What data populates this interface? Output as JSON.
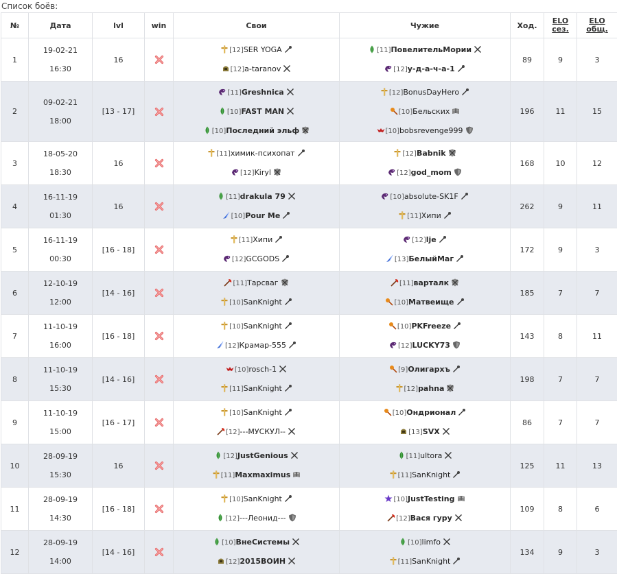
{
  "caption": "Список боёв:",
  "headers": {
    "num": "№",
    "date": "Дата",
    "lvl": "lvl",
    "win": "win",
    "own": "Свои",
    "enemy": "Чужие",
    "moves": "Ход.",
    "elo_season_1": "ELO",
    "elo_season_2": "сез.",
    "elo_total_1": "ELO",
    "elo_total_2": "общ."
  },
  "class_icons": {
    "knight": "cross-icon",
    "warrior": "helmet-icon",
    "druid": "leaf-icon",
    "necro": "dark-swirl-icon",
    "magician": "blue-drop-icon",
    "berserk": "red-axe-icon",
    "alchemist": "orange-key-icon",
    "vampire": "red-bat-icon",
    "demon": "purple-star-icon"
  },
  "status_icons": {
    "staff": "staff-icon",
    "cross": "dead-cross-icon",
    "shield": "shield-icon",
    "dead": "hatched-shield-icon",
    "book": "book-icon"
  },
  "battles": [
    {
      "num": "1",
      "date": "19-02-21",
      "time": "16:30",
      "lvl": "16",
      "own": [
        {
          "cls": "knight",
          "lvl": "[12]",
          "name": "SER YOGA",
          "bold": false,
          "st": "staff"
        },
        {
          "cls": "warrior",
          "lvl": "[12]",
          "name": "a-taranov",
          "bold": false,
          "st": "cross"
        }
      ],
      "enemy": [
        {
          "cls": "druid",
          "lvl": "[11]",
          "name": "ПовелительМории",
          "bold": true,
          "st": "cross"
        },
        {
          "cls": "necro",
          "lvl": "[12]",
          "name": "у-д-а-ч-а-1",
          "bold": true,
          "st": "staff"
        }
      ],
      "moves": "89",
      "elo_season": "9",
      "elo_total": "3"
    },
    {
      "num": "2",
      "date": "09-02-21",
      "time": "18:00",
      "lvl": "[13 - 17]",
      "own": [
        {
          "cls": "necro",
          "lvl": "[11]",
          "name": "Greshnica",
          "bold": true,
          "st": "cross"
        },
        {
          "cls": "druid",
          "lvl": "[10]",
          "name": "FAST MAN",
          "bold": true,
          "st": "cross"
        },
        {
          "cls": "druid",
          "lvl": "[10]",
          "name": "Последний эльф",
          "bold": true,
          "st": "dead"
        }
      ],
      "enemy": [
        {
          "cls": "knight",
          "lvl": "[12]",
          "name": "BonusDayHero",
          "bold": false,
          "st": "staff"
        },
        {
          "cls": "alchemist",
          "lvl": "[10]",
          "name": "Бельских",
          "bold": false,
          "st": "book"
        },
        {
          "cls": "vampire",
          "lvl": "[10]",
          "name": "bobsrevenge999",
          "bold": false,
          "st": "shield"
        }
      ],
      "moves": "196",
      "elo_season": "11",
      "elo_total": "15"
    },
    {
      "num": "3",
      "date": "18-05-20",
      "time": "18:30",
      "lvl": "16",
      "own": [
        {
          "cls": "knight",
          "lvl": "[11]",
          "name": "химик-психопат",
          "bold": false,
          "st": "staff"
        },
        {
          "cls": "necro",
          "lvl": "[12]",
          "name": "Kiryl",
          "bold": false,
          "st": "dead"
        }
      ],
      "enemy": [
        {
          "cls": "knight",
          "lvl": "[12]",
          "name": "Babnik",
          "bold": true,
          "st": "dead"
        },
        {
          "cls": "necro",
          "lvl": "[12]",
          "name": "god_mom",
          "bold": true,
          "st": "shield"
        }
      ],
      "moves": "168",
      "elo_season": "10",
      "elo_total": "12"
    },
    {
      "num": "4",
      "date": "16-11-19",
      "time": "01:30",
      "lvl": "16",
      "own": [
        {
          "cls": "druid",
          "lvl": "[11]",
          "name": "drakula 79",
          "bold": true,
          "st": "cross"
        },
        {
          "cls": "magician",
          "lvl": "[10]",
          "name": "Pour Me",
          "bold": true,
          "st": "staff"
        }
      ],
      "enemy": [
        {
          "cls": "necro",
          "lvl": "[10]",
          "name": "absolute-SK1F",
          "bold": false,
          "st": "staff"
        },
        {
          "cls": "knight",
          "lvl": "[11]",
          "name": "Хипи",
          "bold": false,
          "st": "staff"
        }
      ],
      "moves": "262",
      "elo_season": "9",
      "elo_total": "11"
    },
    {
      "num": "5",
      "date": "16-11-19",
      "time": "00:30",
      "lvl": "[16 - 18]",
      "own": [
        {
          "cls": "knight",
          "lvl": "[11]",
          "name": "Хипи",
          "bold": false,
          "st": "staff"
        },
        {
          "cls": "necro",
          "lvl": "[12]",
          "name": "GCGODS",
          "bold": false,
          "st": "staff"
        }
      ],
      "enemy": [
        {
          "cls": "necro",
          "lvl": "[12]",
          "name": "lje",
          "bold": true,
          "st": "staff"
        },
        {
          "cls": "magician",
          "lvl": "[13]",
          "name": "БелыйМаг",
          "bold": true,
          "st": "staff"
        }
      ],
      "moves": "172",
      "elo_season": "9",
      "elo_total": "3"
    },
    {
      "num": "6",
      "date": "12-10-19",
      "time": "12:00",
      "lvl": "[14 - 16]",
      "own": [
        {
          "cls": "berserk",
          "lvl": "[11]",
          "name": "Тарсваг",
          "bold": false,
          "st": "dead"
        },
        {
          "cls": "knight",
          "lvl": "[10]",
          "name": "SanKnight",
          "bold": false,
          "st": "staff"
        }
      ],
      "enemy": [
        {
          "cls": "berserk",
          "lvl": "[11]",
          "name": "варталк",
          "bold": true,
          "st": "dead"
        },
        {
          "cls": "alchemist",
          "lvl": "[10]",
          "name": "Матвеище",
          "bold": true,
          "st": "staff"
        }
      ],
      "moves": "185",
      "elo_season": "7",
      "elo_total": "7"
    },
    {
      "num": "7",
      "date": "11-10-19",
      "time": "16:00",
      "lvl": "[16 - 18]",
      "own": [
        {
          "cls": "knight",
          "lvl": "[10]",
          "name": "SanKnight",
          "bold": false,
          "st": "staff"
        },
        {
          "cls": "magician",
          "lvl": "[12]",
          "name": "Крамар-555",
          "bold": false,
          "st": "staff"
        }
      ],
      "enemy": [
        {
          "cls": "alchemist",
          "lvl": "[10]",
          "name": "PKFreeze",
          "bold": true,
          "st": "staff"
        },
        {
          "cls": "necro",
          "lvl": "[12]",
          "name": "LUCKY73",
          "bold": true,
          "st": "shield"
        }
      ],
      "moves": "143",
      "elo_season": "8",
      "elo_total": "11"
    },
    {
      "num": "8",
      "date": "11-10-19",
      "time": "15:30",
      "lvl": "[14 - 16]",
      "own": [
        {
          "cls": "vampire",
          "lvl": "[10]",
          "name": "rosch-1",
          "bold": false,
          "st": "cross"
        },
        {
          "cls": "knight",
          "lvl": "[11]",
          "name": "SanKnight",
          "bold": false,
          "st": "staff"
        }
      ],
      "enemy": [
        {
          "cls": "alchemist",
          "lvl": "[9]",
          "name": "Олигархъ",
          "bold": true,
          "st": "staff"
        },
        {
          "cls": "knight",
          "lvl": "[12]",
          "name": "pahna",
          "bold": true,
          "st": "dead"
        }
      ],
      "moves": "198",
      "elo_season": "7",
      "elo_total": "7"
    },
    {
      "num": "9",
      "date": "11-10-19",
      "time": "15:00",
      "lvl": "[16 - 17]",
      "own": [
        {
          "cls": "knight",
          "lvl": "[10]",
          "name": "SanKnight",
          "bold": false,
          "st": "staff"
        },
        {
          "cls": "berserk",
          "lvl": "[12]",
          "name": "---МУСКУЛ--",
          "bold": false,
          "st": "cross"
        }
      ],
      "enemy": [
        {
          "cls": "alchemist",
          "lvl": "[10]",
          "name": "Ондрионал",
          "bold": true,
          "st": "staff"
        },
        {
          "cls": "warrior",
          "lvl": "[13]",
          "name": "SVX",
          "bold": true,
          "st": "cross"
        }
      ],
      "moves": "86",
      "elo_season": "7",
      "elo_total": "7"
    },
    {
      "num": "10",
      "date": "28-09-19",
      "time": "15:30",
      "lvl": "16",
      "own": [
        {
          "cls": "druid",
          "lvl": "[12]",
          "name": "JustGenious",
          "bold": true,
          "st": "cross"
        },
        {
          "cls": "knight",
          "lvl": "[11]",
          "name": "Maxmaximus",
          "bold": true,
          "st": "book"
        }
      ],
      "enemy": [
        {
          "cls": "druid",
          "lvl": "[11]",
          "name": "ultora",
          "bold": false,
          "st": "cross"
        },
        {
          "cls": "knight",
          "lvl": "[11]",
          "name": "SanKnight",
          "bold": false,
          "st": "staff"
        }
      ],
      "moves": "125",
      "elo_season": "11",
      "elo_total": "13"
    },
    {
      "num": "11",
      "date": "28-09-19",
      "time": "14:30",
      "lvl": "[16 - 18]",
      "own": [
        {
          "cls": "knight",
          "lvl": "[10]",
          "name": "SanKnight",
          "bold": false,
          "st": "staff"
        },
        {
          "cls": "druid",
          "lvl": "[12]",
          "name": "---Леонид---",
          "bold": false,
          "st": "shield"
        }
      ],
      "enemy": [
        {
          "cls": "demon",
          "lvl": "[10]",
          "name": "JustTesting",
          "bold": true,
          "st": "book"
        },
        {
          "cls": "berserk",
          "lvl": "[12]",
          "name": "Вася гуру",
          "bold": true,
          "st": "cross"
        }
      ],
      "moves": "109",
      "elo_season": "8",
      "elo_total": "6"
    },
    {
      "num": "12",
      "date": "28-09-19",
      "time": "14:00",
      "lvl": "[14 - 16]",
      "own": [
        {
          "cls": "druid",
          "lvl": "[10]",
          "name": "ВнеСистемы",
          "bold": true,
          "st": "cross"
        },
        {
          "cls": "warrior",
          "lvl": "[12]",
          "name": "2015ВОИН",
          "bold": true,
          "st": "cross"
        }
      ],
      "enemy": [
        {
          "cls": "druid",
          "lvl": "[10]",
          "name": "limfo",
          "bold": false,
          "st": "cross"
        },
        {
          "cls": "knight",
          "lvl": "[11]",
          "name": "SanKnight",
          "bold": false,
          "st": "staff"
        }
      ],
      "moves": "134",
      "elo_season": "9",
      "elo_total": "3"
    }
  ]
}
